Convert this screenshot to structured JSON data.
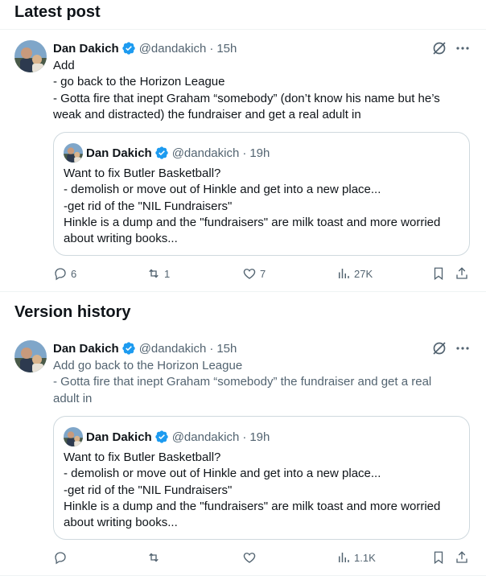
{
  "latest": {
    "section_title": "Latest post",
    "post": {
      "name": "Dan Dakich",
      "handle": "@dandakich",
      "time": "15h",
      "lines": [
        "Add",
        "- go back to the Horizon League",
        "- Gotta fire that inept Graham “somebody” (don’t know his name but he’s",
        "weak and distracted) the fundraiser and get a real adult in"
      ],
      "quote": {
        "name": "Dan Dakich",
        "handle": "@dandakich",
        "time": "19h",
        "lines": [
          "Want to fix Butler Basketball?",
          "- demolish or move out of Hinkle and get into a new place...",
          "-get rid of the \"NIL Fundraisers\"",
          "Hinkle is a dump and the \"fundraisers\" are milk toast and more worried",
          "about writing books..."
        ]
      },
      "stats": {
        "replies": "6",
        "reposts": "1",
        "likes": "7",
        "views": "27K"
      }
    }
  },
  "history": {
    "section_title": "Version history",
    "post": {
      "name": "Dan Dakich",
      "handle": "@dandakich",
      "time": "15h",
      "lines": [
        "Add go back to the Horizon League",
        "- Gotta fire that inept Graham “somebody” the fundraiser and get a real",
        "adult in"
      ],
      "quote": {
        "name": "Dan Dakich",
        "handle": "@dandakich",
        "time": "19h",
        "lines": [
          "Want to fix Butler Basketball?",
          "- demolish or move out of Hinkle and get into a new place...",
          "-get rid of the \"NIL Fundraisers\"",
          "Hinkle is a dump and the \"fundraisers\" are milk toast and more worried",
          "about writing books..."
        ]
      },
      "stats": {
        "replies": "",
        "reposts": "",
        "likes": "",
        "views": "1.1K"
      }
    }
  },
  "separator": "·",
  "icons": {
    "verified": "verified-badge-icon",
    "grok": "grok-icon",
    "more": "more-icon",
    "reply": "reply-icon",
    "repost": "repost-icon",
    "like": "like-icon",
    "views": "views-icon",
    "bookmark": "bookmark-icon",
    "share": "share-icon"
  },
  "colors": {
    "accent": "#1d9bf0",
    "muted": "#536471",
    "border": "#cfd9de",
    "text": "#0f1419"
  }
}
